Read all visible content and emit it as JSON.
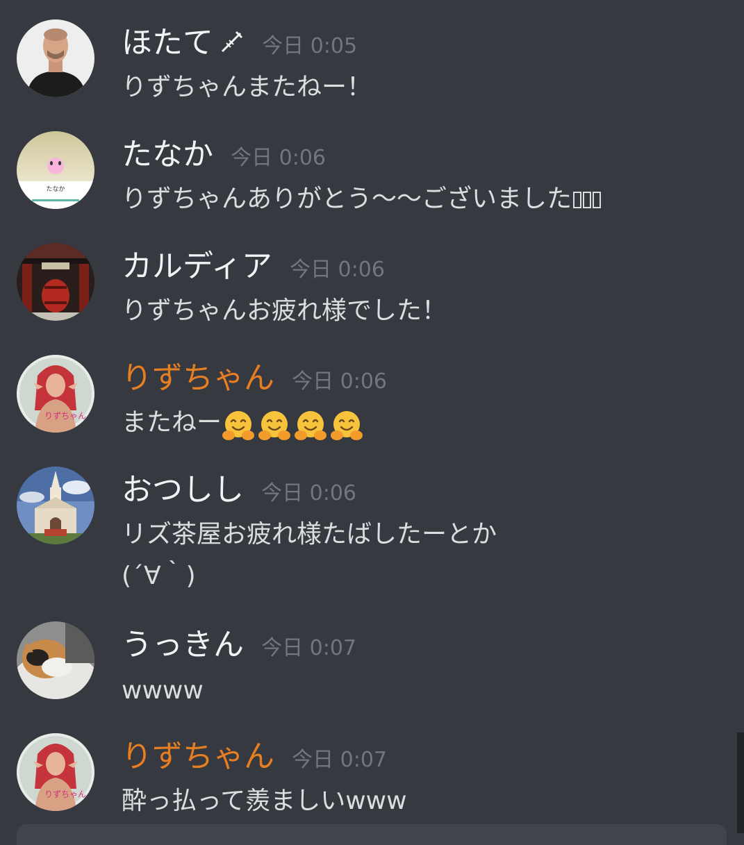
{
  "messages": [
    {
      "author": "ほたて",
      "author_suffix_icon": "syringe-icon",
      "time": "今日 0:05",
      "text": "りずちゃんまたねー！",
      "avatar": "man-in-black-tshirt"
    },
    {
      "author": "たなか",
      "time": "今日 0:06",
      "text": "りずちゃんありがとう〜〜ございました",
      "avatar": "pink-character-card",
      "avatar_text": "たなか"
    },
    {
      "author": "カルディア",
      "time": "今日 0:06",
      "text": "りずちゃんお疲れ様でした！",
      "avatar": "temple-gate"
    },
    {
      "author": "りずちゃん",
      "time": "今日 0:06",
      "text": "またねー",
      "emoji": "hugging-face-icon",
      "emoji_count": 4,
      "avatar": "red-haired-elf",
      "avatar_text": "りずちゃん",
      "author_color": "#e67e22"
    },
    {
      "author": "おつしし",
      "time": "今日 0:06",
      "text": "リズ茶屋お疲れ様たばしたーとか",
      "text2": "(´∀｀)",
      "avatar": "church"
    },
    {
      "author": "うっきん",
      "time": "今日 0:07",
      "text": "wwww",
      "avatar": "calico-cat"
    },
    {
      "author": "りずちゃん",
      "time": "今日 0:07",
      "text": "酔っ払って羨ましいwww",
      "avatar": "red-haired-elf",
      "avatar_text": "りずちゃん",
      "author_color": "#e67e22"
    }
  ],
  "colors": {
    "background": "#36393f",
    "author_default": "#f2f3f5",
    "author_highlight": "#e67e22",
    "timestamp": "#72767d",
    "message_text": "#dcddde"
  }
}
